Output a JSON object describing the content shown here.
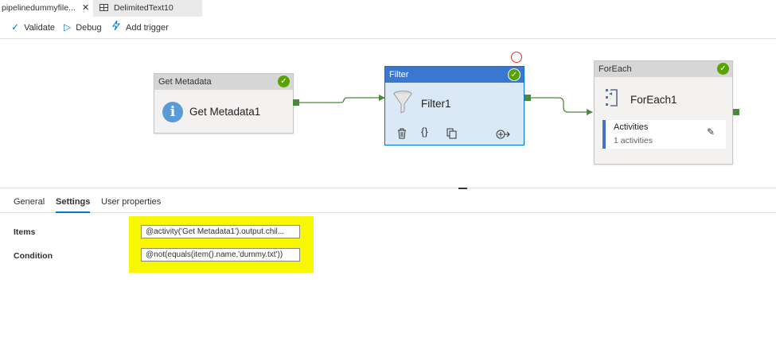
{
  "tabs": [
    {
      "label": "pipelinedummyfile...",
      "close": "✕",
      "active": true
    },
    {
      "label": "DelimitedText10",
      "active": false
    }
  ],
  "toolbar": {
    "validate_label": "Validate",
    "debug_label": "Debug",
    "add_trigger_label": "Add trigger"
  },
  "canvas": {
    "nodes": {
      "get_metadata": {
        "header": "Get Metadata",
        "title": "Get Metadata1",
        "status": "succeeded"
      },
      "filter": {
        "header": "Filter",
        "title": "Filter1",
        "status": "succeeded",
        "selected": true
      },
      "foreach": {
        "header": "ForEach",
        "title": "ForEach1",
        "status": "succeeded",
        "activities_label": "Activities",
        "activities_count": "1 activities"
      }
    },
    "icons": {
      "status": "check-circle-icon",
      "delete": "trash-icon",
      "code": "braces-icon",
      "copy": "copy-icon",
      "add_output": "add-output-icon",
      "edit": "pencil-icon"
    },
    "colors": {
      "success": "#57a300",
      "filter_header": "#3a77d0",
      "connector": "#4b8a3d",
      "accent": "#0078d4",
      "highlight": "#f7f700"
    }
  },
  "properties": {
    "tabs": [
      {
        "label": "General",
        "selected": false
      },
      {
        "label": "Settings",
        "selected": true
      },
      {
        "label": "User properties",
        "selected": false
      }
    ],
    "fields": {
      "items": {
        "label": "Items",
        "value": "@activity('Get Metadata1').output.chil..."
      },
      "condition": {
        "label": "Condition",
        "value": "@not(equals(item().name,'dummy.txt'))"
      }
    }
  }
}
